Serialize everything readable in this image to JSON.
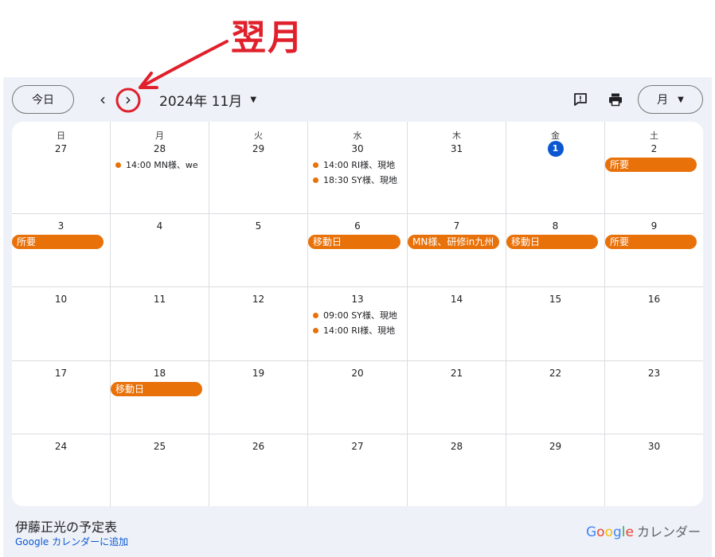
{
  "annotation": {
    "label": "翌月"
  },
  "toolbar": {
    "today_label": "今日",
    "prev_glyph": "‹",
    "next_glyph": "›",
    "month_title": "2024年 11月",
    "view_label": "月",
    "icons": [
      "feedback-icon",
      "print-icon",
      "chevron-down-icon"
    ]
  },
  "calendar": {
    "weekday_headers": [
      "日",
      "月",
      "火",
      "水",
      "木",
      "金",
      "土"
    ],
    "weeks": [
      [
        {
          "day": "27",
          "events": []
        },
        {
          "day": "28",
          "events": [
            {
              "kind": "dot",
              "text": "14:00 MN様、we"
            }
          ]
        },
        {
          "day": "29",
          "events": []
        },
        {
          "day": "30",
          "events": [
            {
              "kind": "dot",
              "text": "14:00 RI様、現地"
            },
            {
              "kind": "dot",
              "text": "18:30 SY様、現地"
            }
          ]
        },
        {
          "day": "31",
          "events": []
        },
        {
          "day": "1",
          "today": true,
          "events": []
        },
        {
          "day": "2",
          "events": [
            {
              "kind": "bar",
              "text": "所要"
            }
          ]
        }
      ],
      [
        {
          "day": "3",
          "events": [
            {
              "kind": "bar",
              "text": "所要"
            }
          ]
        },
        {
          "day": "4",
          "events": []
        },
        {
          "day": "5",
          "events": []
        },
        {
          "day": "6",
          "events": [
            {
              "kind": "bar",
              "text": "移動日"
            }
          ]
        },
        {
          "day": "7",
          "events": [
            {
              "kind": "bar",
              "text": "MN様、研修in九州"
            }
          ]
        },
        {
          "day": "8",
          "events": [
            {
              "kind": "bar",
              "text": "移動日"
            }
          ]
        },
        {
          "day": "9",
          "events": [
            {
              "kind": "bar",
              "text": "所要"
            }
          ]
        }
      ],
      [
        {
          "day": "10",
          "events": []
        },
        {
          "day": "11",
          "events": []
        },
        {
          "day": "12",
          "events": []
        },
        {
          "day": "13",
          "events": [
            {
              "kind": "dot",
              "text": "09:00 SY様、現地"
            },
            {
              "kind": "dot",
              "text": "14:00 RI様、現地"
            }
          ]
        },
        {
          "day": "14",
          "events": []
        },
        {
          "day": "15",
          "events": []
        },
        {
          "day": "16",
          "events": []
        }
      ],
      [
        {
          "day": "17",
          "events": []
        },
        {
          "day": "18",
          "events": [
            {
              "kind": "bar",
              "text": "移動日"
            }
          ]
        },
        {
          "day": "19",
          "events": []
        },
        {
          "day": "20",
          "events": []
        },
        {
          "day": "21",
          "events": []
        },
        {
          "day": "22",
          "events": []
        },
        {
          "day": "23",
          "events": []
        }
      ],
      [
        {
          "day": "24",
          "events": []
        },
        {
          "day": "25",
          "events": []
        },
        {
          "day": "26",
          "events": []
        },
        {
          "day": "27",
          "events": []
        },
        {
          "day": "28",
          "events": []
        },
        {
          "day": "29",
          "events": []
        },
        {
          "day": "30",
          "events": []
        }
      ]
    ],
    "event_color": "#e8710a",
    "today_color": "#0b57d0"
  },
  "footer": {
    "calendar_name": "伊藤正光の予定表",
    "add_link": "Google カレンダーに追加",
    "brand_letters": [
      "G",
      "o",
      "o",
      "g",
      "l",
      "e"
    ],
    "brand_suffix": "カレンダー"
  }
}
